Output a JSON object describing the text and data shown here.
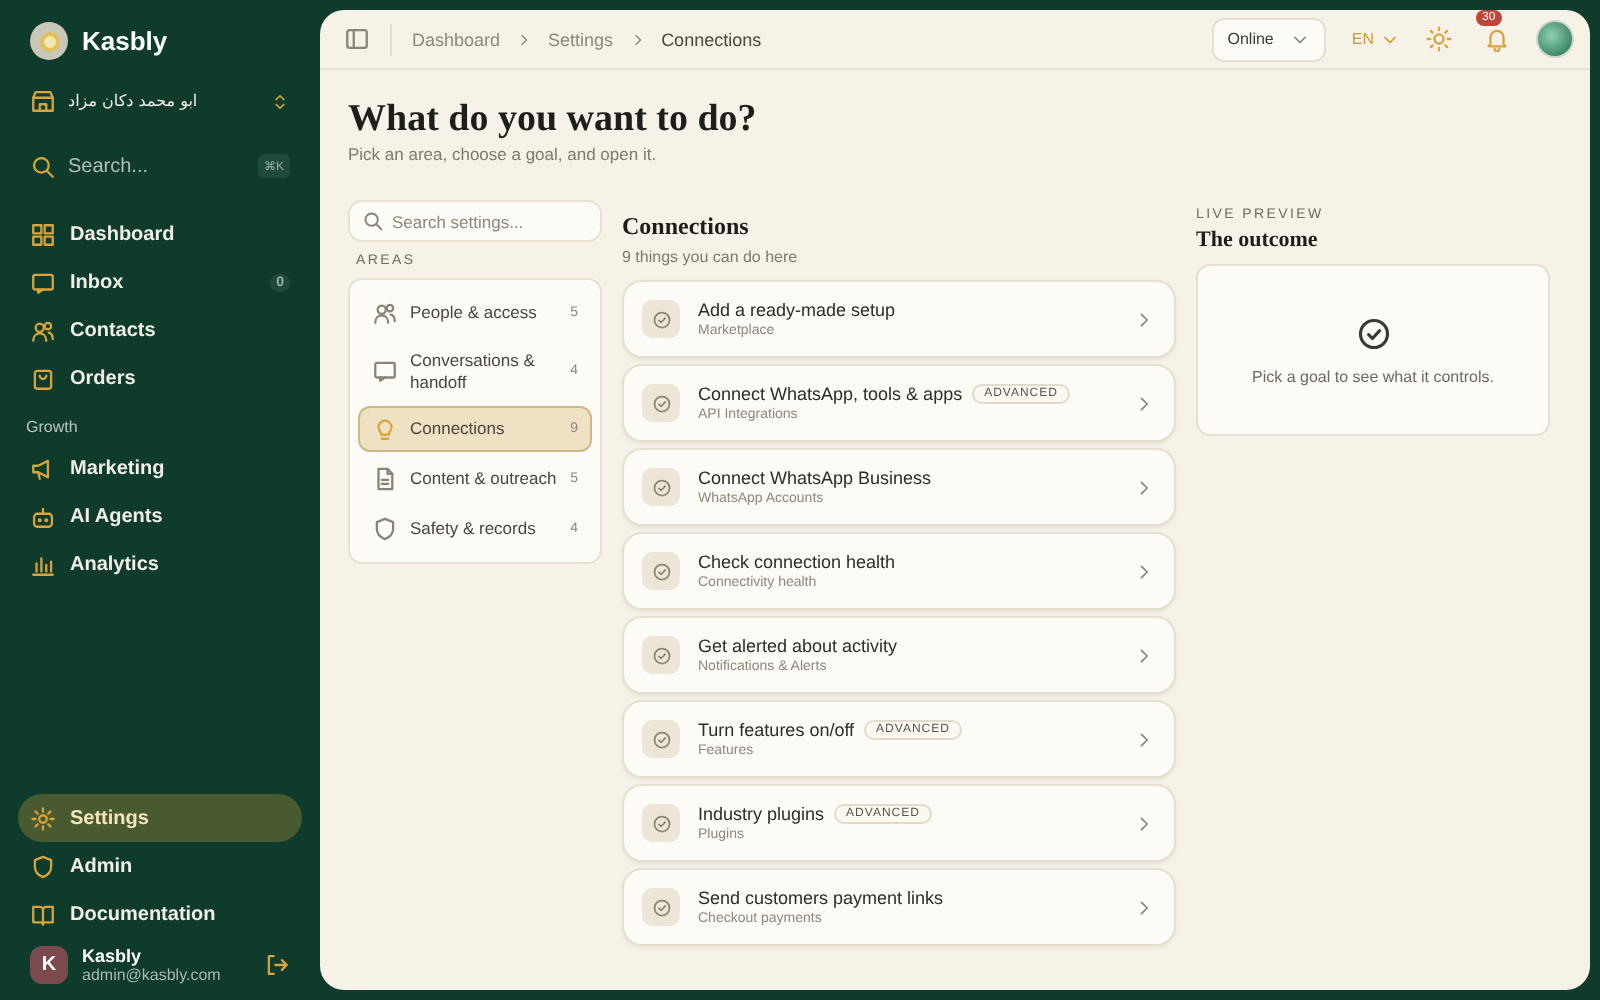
{
  "sidebar": {
    "brand": "Kasbly",
    "workspace": "ابو محمد دكان مزاد",
    "search": {
      "placeholder": "Search...",
      "shortcut": "⌘K"
    },
    "items": [
      {
        "label": "Dashboard",
        "selected": false
      },
      {
        "label": "Inbox",
        "selected": false,
        "badge": "0"
      },
      {
        "label": "Contacts",
        "selected": false
      },
      {
        "label": "Orders",
        "selected": false
      }
    ],
    "section": "Growth",
    "growth_items": [
      {
        "label": "Marketing",
        "selected": false
      },
      {
        "label": "AI Agents",
        "selected": false
      },
      {
        "label": "Analytics",
        "selected": false
      }
    ],
    "bottom_items": [
      {
        "label": "Settings",
        "selected": true
      },
      {
        "label": "Admin",
        "selected": false
      },
      {
        "label": "Documentation",
        "selected": false
      }
    ],
    "user": {
      "initial": "K",
      "name": "Kasbly",
      "email": "admin@kasbly.com"
    }
  },
  "topbar": {
    "breadcrumbs": [
      "Dashboard",
      "Settings",
      "Connections"
    ],
    "status": "Online",
    "language": "EN",
    "notifications": "30"
  },
  "page": {
    "title": "What do you want to do?",
    "subtitle": "Pick an area, choose a goal, and open it."
  },
  "areas": {
    "search_placeholder": "Search settings...",
    "heading": "AREAS",
    "items": [
      {
        "label": "People & access",
        "count": "5",
        "selected": false
      },
      {
        "label": "Conversations & handoff",
        "count": "4",
        "selected": false
      },
      {
        "label": "Connections",
        "count": "9",
        "selected": true
      },
      {
        "label": "Content & outreach",
        "count": "5",
        "selected": false
      },
      {
        "label": "Safety & records",
        "count": "4",
        "selected": false
      }
    ]
  },
  "goals": {
    "title": "Connections",
    "subtitle": "9 things you can do here",
    "items": [
      {
        "title": "Add a ready-made setup",
        "subtitle": "Marketplace"
      },
      {
        "title": "Connect WhatsApp, tools & apps",
        "subtitle": "API Integrations",
        "badge": "ADVANCED"
      },
      {
        "title": "Connect WhatsApp Business",
        "subtitle": "WhatsApp Accounts"
      },
      {
        "title": "Check connection health",
        "subtitle": "Connectivity health"
      },
      {
        "title": "Get alerted about activity",
        "subtitle": "Notifications & Alerts"
      },
      {
        "title": "Turn features on/off",
        "subtitle": "Features",
        "badge": "ADVANCED"
      },
      {
        "title": "Industry plugins",
        "subtitle": "Plugins",
        "badge": "ADVANCED"
      },
      {
        "title": "Send customers payment links",
        "subtitle": "Checkout payments"
      }
    ]
  },
  "preview": {
    "label": "LIVE PREVIEW",
    "title": "The outcome",
    "message": "Pick a goal to see what it controls."
  }
}
